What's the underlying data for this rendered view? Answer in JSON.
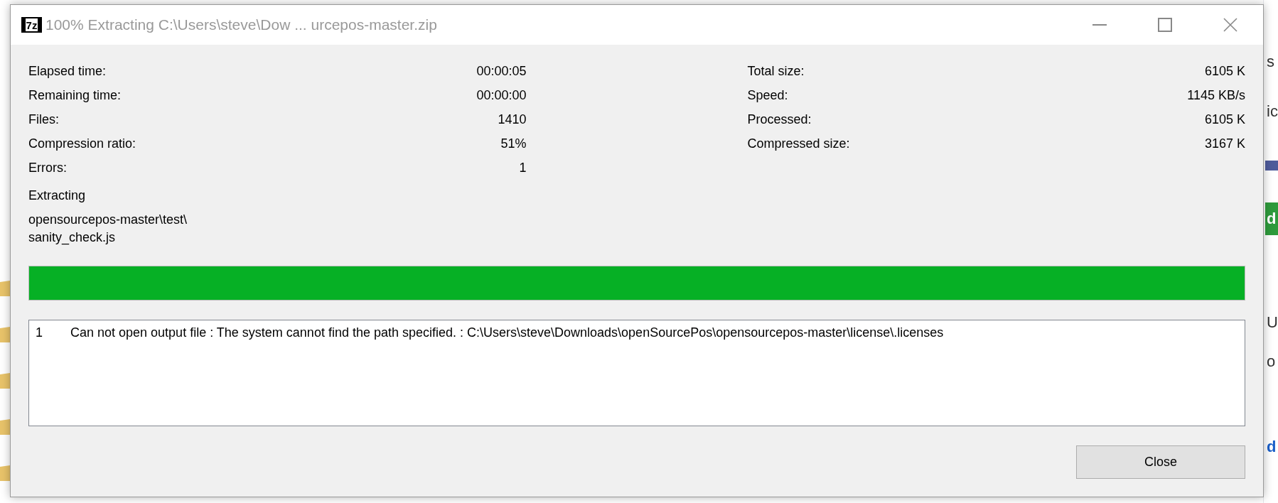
{
  "background": {
    "right_fragments": [
      {
        "text": "s",
        "kind": "plain"
      },
      {
        "text": "ic",
        "kind": "plain"
      },
      {
        "text": "d",
        "kind": "button"
      },
      {
        "text": "U",
        "kind": "plain"
      },
      {
        "text": "o",
        "kind": "plain"
      },
      {
        "text": "d",
        "kind": "link"
      }
    ]
  },
  "window": {
    "title": "100% Extracting C:\\Users\\steve\\Dow ... urcepos-master.zip",
    "app_icon": "7z"
  },
  "stats_left": [
    {
      "label": "Elapsed time:",
      "value": "00:00:05"
    },
    {
      "label": "Remaining time:",
      "value": "00:00:00"
    },
    {
      "label": "Files:",
      "value": "1410"
    },
    {
      "label": "Compression ratio:",
      "value": "51%"
    },
    {
      "label": "Errors:",
      "value": "1"
    }
  ],
  "stats_right": [
    {
      "label": "Total size:",
      "value": "6105 K"
    },
    {
      "label": "Speed:",
      "value": "1145 KB/s"
    },
    {
      "label": "Processed:",
      "value": "6105 K"
    },
    {
      "label": "Compressed size:",
      "value": "3167 K"
    }
  ],
  "status": "Extracting",
  "current_path": [
    "opensourcepos-master\\test\\",
    "sanity_check.js"
  ],
  "progress": {
    "level": 1.0
  },
  "errors": [
    {
      "number": "1",
      "message": "Can not open output file : The system cannot find the path specified. : C:\\Users\\steve\\Downloads\\openSourcePos\\opensourcepos-master\\license\\.licenses"
    }
  ],
  "buttons": [
    "Close"
  ]
}
